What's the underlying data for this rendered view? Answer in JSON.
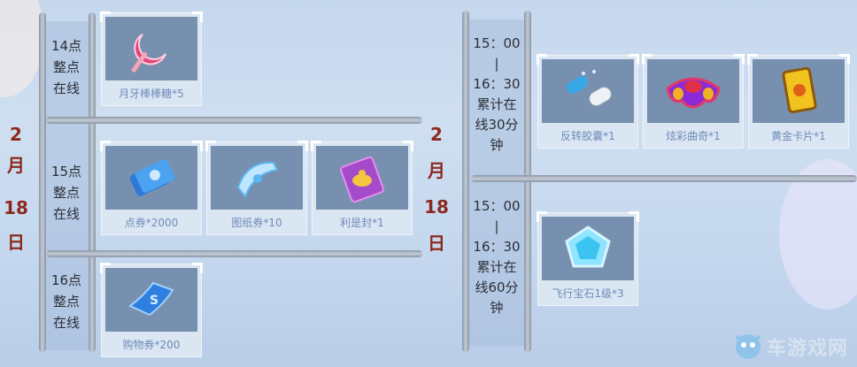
{
  "dates": {
    "left": [
      "2",
      "月",
      "18",
      "日"
    ],
    "right": [
      "2",
      "月",
      "18",
      "日"
    ]
  },
  "left_rows": [
    {
      "time": [
        "14点",
        "整点",
        "在线"
      ],
      "rewards": [
        {
          "label": "月牙棒棒糖*5",
          "icon": "lollipop-icon"
        }
      ]
    },
    {
      "time": [
        "15点",
        "整点",
        "在线"
      ],
      "rewards": [
        {
          "label": "点券*2000",
          "icon": "coupon-stack-icon"
        },
        {
          "label": "图纸券*10",
          "icon": "blueprint-ticket-icon"
        },
        {
          "label": "利是封*1",
          "icon": "red-envelope-icon"
        }
      ]
    },
    {
      "time": [
        "16点",
        "整点",
        "在线"
      ],
      "rewards": [
        {
          "label": "购物券*200",
          "icon": "shopping-voucher-icon"
        }
      ]
    }
  ],
  "right_rows": [
    {
      "time": [
        "15：00",
        "|",
        "16：30",
        "累计在",
        "线30分",
        "钟"
      ],
      "rewards": [
        {
          "label": "反转胶囊*1",
          "icon": "capsule-icon"
        },
        {
          "label": "炫彩曲奇*1",
          "icon": "cookie-icon"
        },
        {
          "label": "黄金卡片*1",
          "icon": "gold-card-icon"
        }
      ]
    },
    {
      "time": [
        "15：00",
        "|",
        "16：30",
        "累计在",
        "线60分",
        "钟"
      ],
      "rewards": [
        {
          "label": "飞行宝石1级*3",
          "icon": "gem-icon"
        }
      ]
    }
  ],
  "watermark": "车游戏网",
  "colors": {
    "date": "#8c2a1f",
    "label": "#6e8bb8",
    "card_top": "#7890b0",
    "card": "#dbe6f3"
  }
}
